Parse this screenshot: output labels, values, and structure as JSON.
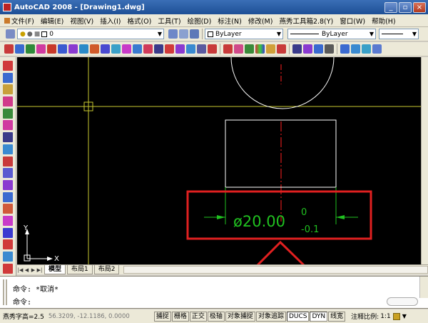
{
  "window": {
    "title": "AutoCAD 2008 - [Drawing1.dwg]",
    "buttons": [
      "_",
      "▫",
      "×"
    ]
  },
  "menu": [
    "文件(F)",
    "编辑(E)",
    "视图(V)",
    "插入(I)",
    "格式(O)",
    "工具(T)",
    "绘图(D)",
    "标注(N)",
    "修改(M)",
    "燕秀工具箱2.8(Y)",
    "窗口(W)",
    "帮助(H)"
  ],
  "toolbar": {
    "layer_value": "0",
    "color_value": "ByLayer",
    "linetype_value": "ByLayer",
    "lineweight_value": "ByLayer"
  },
  "drawing": {
    "dimension_text": "ø20.00",
    "tol_upper": "0",
    "tol_lower": "-0.1",
    "ucs_y": "Y",
    "ucs_x": "X",
    "colors": {
      "crosshair": "#c8c830",
      "dimension": "#20c020",
      "annotation": "#e02020",
      "outline": "#ffffff",
      "centerline": "#ff2020"
    }
  },
  "tabs": [
    "模型",
    "布局1",
    "布局2"
  ],
  "command": {
    "line1": "命令: *取消*",
    "line2": "命令:"
  },
  "status": {
    "label": "燕秀字高=2.5",
    "coords": "56.3209, -12.1186, 0.0000",
    "toggles": [
      "捕捉",
      "栅格",
      "正交",
      "极轴",
      "对象捕捉",
      "对象追踪",
      "DUCS",
      "DYN",
      "线宽"
    ],
    "active_toggles": [
      "DUCS",
      "DYN"
    ],
    "scale_label": "注释比例:",
    "scale_value": "1:1"
  }
}
